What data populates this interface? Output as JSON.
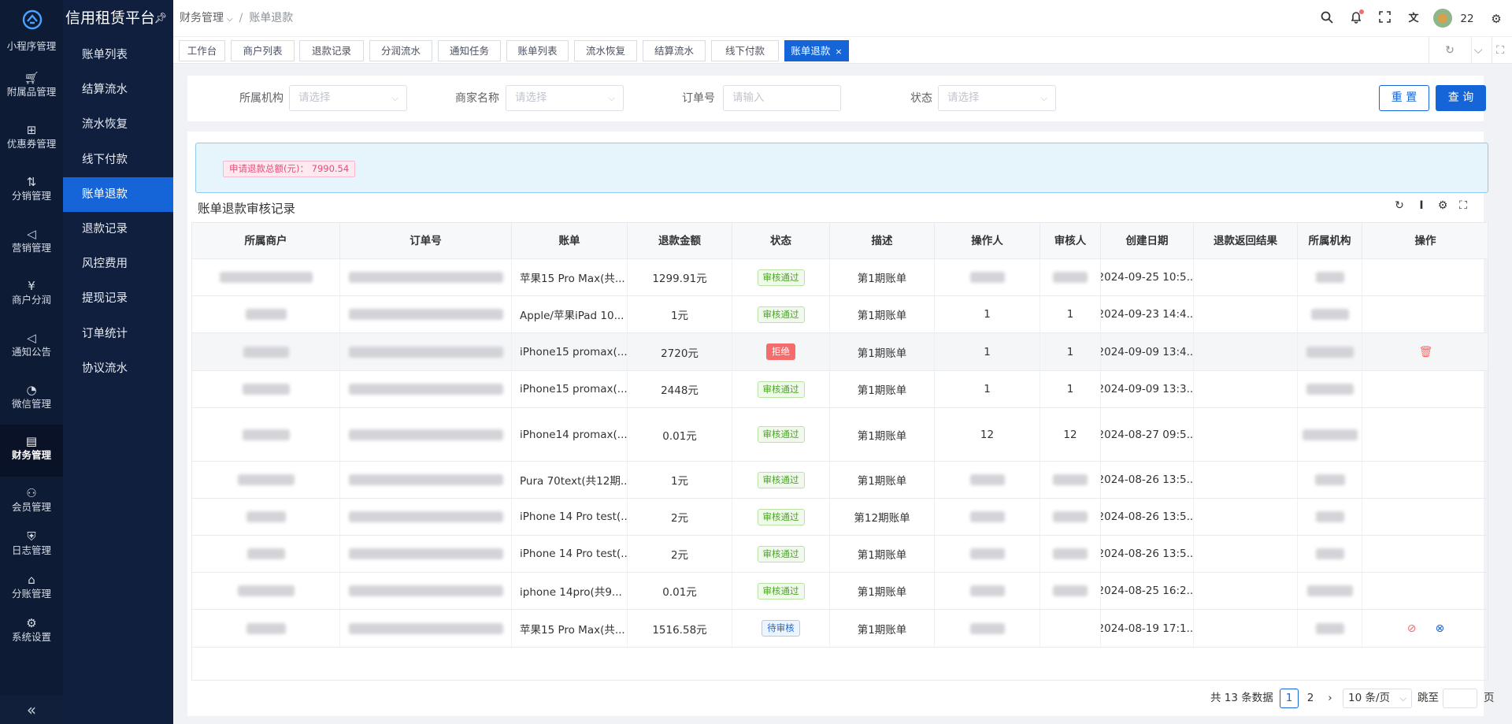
{
  "app": {
    "title": "信用租赁平台"
  },
  "left_nav": [
    {
      "label": "小程序管理",
      "icon": "miniapp-icon"
    },
    {
      "label": "附属品管理",
      "icon": "cart-icon"
    },
    {
      "label": "优惠券管理",
      "icon": "gift-icon"
    },
    {
      "label": "分销管理",
      "icon": "distribution-icon"
    },
    {
      "label": "营销管理",
      "icon": "megaphone-icon"
    },
    {
      "label": "商户分润",
      "icon": "yen-icon"
    },
    {
      "label": "通知公告",
      "icon": "notice-icon"
    },
    {
      "label": "微信管理",
      "icon": "wechat-icon"
    },
    {
      "label": "财务管理",
      "icon": "finance-icon"
    },
    {
      "label": "会员管理",
      "icon": "member-icon"
    },
    {
      "label": "日志管理",
      "icon": "shield-icon"
    },
    {
      "label": "分账管理",
      "icon": "split-icon"
    },
    {
      "label": "系统设置",
      "icon": "gear-icon"
    }
  ],
  "sub_nav": [
    "账单列表",
    "结算流水",
    "流水恢复",
    "线下付款",
    "账单退款",
    "退款记录",
    "风控费用",
    "提现记录",
    "订单统计",
    "协议流水"
  ],
  "breadcrumb": {
    "parent": "财务管理",
    "current": "账单退款"
  },
  "header": {
    "user_count": "22"
  },
  "tabs": [
    "工作台",
    "商户列表",
    "退款记录",
    "分润流水",
    "通知任务",
    "账单列表",
    "流水恢复",
    "结算流水",
    "线下付款",
    "账单退款"
  ],
  "filters": {
    "org_label": "所属机构",
    "org_placeholder": "请选择",
    "merchant_label": "商家名称",
    "merchant_placeholder": "请选择",
    "order_label": "订单号",
    "order_placeholder": "请输入",
    "status_label": "状态",
    "status_placeholder": "请选择",
    "reset": "重 置",
    "search": "查 询"
  },
  "summary": {
    "tag": "申请退款总额(元)： 7990.54"
  },
  "table": {
    "title": "账单退款审核记录",
    "columns": [
      "所属商户",
      "订单号",
      "账单",
      "退款金额",
      "状态",
      "描述",
      "操作人",
      "审核人",
      "创建日期",
      "退款返回结果",
      "所属机构",
      "操作"
    ],
    "rows": [
      {
        "bill": "苹果15 Pro Max(共...",
        "amount": "1299.91元",
        "status": "审核通过",
        "status_type": "ok",
        "desc": "第1期账单",
        "operator": "",
        "auditor": "",
        "date": "2024-09-25 10:5...",
        "actions": []
      },
      {
        "bill": "Apple/苹果iPad 10...",
        "amount": "1元",
        "status": "审核通过",
        "status_type": "ok",
        "desc": "第1期账单",
        "operator": "1",
        "auditor": "1",
        "date": "2024-09-23 14:4...",
        "actions": []
      },
      {
        "bill": "iPhone15 promax(...",
        "amount": "2720元",
        "status": "拒绝",
        "status_type": "rej",
        "desc": "第1期账单",
        "operator": "1",
        "auditor": "1",
        "date": "2024-09-09 13:4...",
        "actions": [
          "delete"
        ]
      },
      {
        "bill": "iPhone15 promax(...",
        "amount": "2448元",
        "status": "审核通过",
        "status_type": "ok",
        "desc": "第1期账单",
        "operator": "1",
        "auditor": "1",
        "date": "2024-09-09 13:3...",
        "actions": []
      },
      {
        "bill": "iPhone14 promax(...",
        "amount": "0.01元",
        "status": "审核通过",
        "status_type": "ok",
        "desc": "第1期账单",
        "operator": "12",
        "auditor": "12",
        "date": "2024-08-27 09:5...",
        "actions": []
      },
      {
        "bill": "Pura 70text(共12期...",
        "amount": "1元",
        "status": "审核通过",
        "status_type": "ok",
        "desc": "第1期账单",
        "operator": "",
        "auditor": "",
        "date": "2024-08-26 13:5...",
        "actions": []
      },
      {
        "bill": "iPhone 14 Pro test(...",
        "amount": "2元",
        "status": "审核通过",
        "status_type": "ok",
        "desc": "第12期账单",
        "operator": "",
        "auditor": "",
        "date": "2024-08-26 13:5...",
        "actions": []
      },
      {
        "bill": "iPhone 14 Pro test(...",
        "amount": "2元",
        "status": "审核通过",
        "status_type": "ok",
        "desc": "第1期账单",
        "operator": "",
        "auditor": "",
        "date": "2024-08-26 13:5...",
        "actions": []
      },
      {
        "bill": "iphone 14pro(共9...",
        "amount": "0.01元",
        "status": "审核通过",
        "status_type": "ok",
        "desc": "第1期账单",
        "operator": "",
        "auditor": "",
        "date": "2024-08-25 16:2...",
        "actions": []
      },
      {
        "bill": "苹果15 Pro Max(共...",
        "amount": "1516.58元",
        "status": "待审核",
        "status_type": "pend",
        "desc": "第1期账单",
        "operator": "",
        "auditor": "",
        "date": "2024-08-19 17:1...",
        "actions": [
          "approve",
          "reject"
        ]
      }
    ]
  },
  "pagination": {
    "total": "共 13 条数据",
    "pages": [
      "1",
      "2"
    ],
    "current": "1",
    "page_size": "10 条/页",
    "jump_label": "跳至",
    "page_suffix": "页"
  },
  "colors": {
    "primary": "#1565d8",
    "sidebar": "#0d1b34",
    "success": "#4aa526",
    "danger": "#f56c6c"
  }
}
